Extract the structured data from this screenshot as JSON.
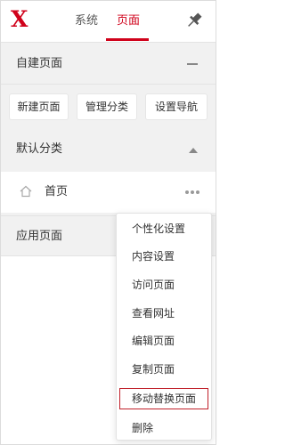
{
  "header": {
    "logo": "X",
    "tabs": [
      {
        "label": "系统",
        "active": false
      },
      {
        "label": "页面",
        "active": true
      }
    ],
    "pin_icon": "pin-icon"
  },
  "sections": {
    "custom_pages": {
      "title": "自建页面",
      "toggle_icon": "minus-icon",
      "buttons": [
        {
          "label": "新建页面"
        },
        {
          "label": "管理分类"
        },
        {
          "label": "设置导航"
        }
      ]
    },
    "default_category": {
      "title": "默认分类",
      "toggle_icon": "triangle-up-icon",
      "pages": [
        {
          "label": "首页",
          "icon": "home-icon",
          "more_icon": "more-icon"
        }
      ]
    },
    "app_pages": {
      "title": "应用页面"
    }
  },
  "context_menu": {
    "items": [
      {
        "label": "个性化设置"
      },
      {
        "label": "内容设置"
      },
      {
        "label": "访问页面"
      },
      {
        "label": "查看网址"
      },
      {
        "label": "编辑页面"
      },
      {
        "label": "复制页面"
      },
      {
        "label": "移动替换页面",
        "highlighted": true
      },
      {
        "label": "删除"
      }
    ]
  },
  "colors": {
    "accent": "#d0021b",
    "panel_bg": "#f1f1f1",
    "highlight_border": "#c0202a"
  }
}
